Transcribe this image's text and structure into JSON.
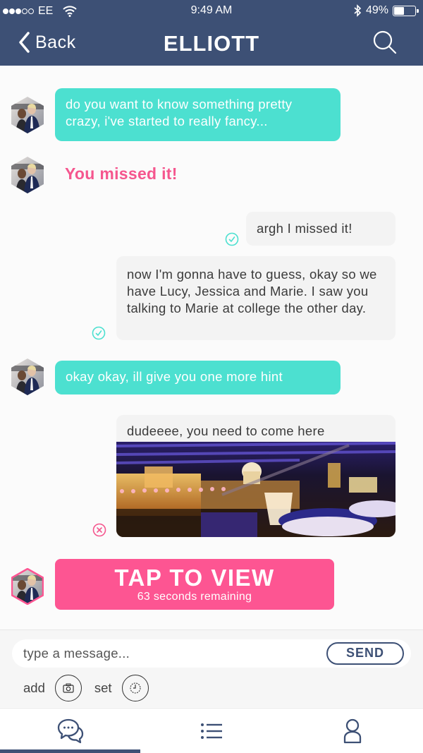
{
  "status_bar": {
    "carrier": "EE",
    "signal_bars_filled": 3,
    "signal_bars_total": 5,
    "time": "9:49 AM",
    "battery_percent_label": "49%",
    "battery_level": 0.49
  },
  "nav": {
    "back_label": "Back",
    "title": "ELLIOTT"
  },
  "colors": {
    "header": "#3d5075",
    "incoming_bubble": "#4ce0d0",
    "accent_pink": "#fd5592",
    "check_teal": "#4ce0d0",
    "error_pink": "#f5568e"
  },
  "messages": [
    {
      "direction": "incoming",
      "text": "do you want to know something pretty crazy, i've started to really fancy..."
    },
    {
      "direction": "incoming",
      "type": "missed",
      "text": "You missed it!"
    },
    {
      "direction": "outgoing",
      "text": "argh I missed it!",
      "status": "delivered"
    },
    {
      "direction": "outgoing",
      "text": "now I'm gonna have to guess, okay so we have Lucy, Jessica and Marie. I saw you talking to Marie at college the other day.",
      "status": "delivered"
    },
    {
      "direction": "incoming",
      "text": "okay okay, ill give you one more hint"
    },
    {
      "direction": "outgoing",
      "type": "photo",
      "text": "dudeeee, you need to come here",
      "image_desc": "night-time rooftop restaurant overlooking London skyline with St Paul's Cathedral",
      "status": "failed"
    },
    {
      "direction": "incoming",
      "type": "timed",
      "title": "TAP TO VIEW",
      "subtitle": "63 seconds remaining"
    }
  ],
  "composer": {
    "placeholder": "type a message...",
    "send_label": "SEND",
    "add_label": "add",
    "set_label": "set"
  },
  "tabbar": {
    "tabs": [
      {
        "name": "chats",
        "icon": "chat-bubbles-icon",
        "active": true
      },
      {
        "name": "list",
        "icon": "list-icon",
        "active": false
      },
      {
        "name": "profile",
        "icon": "person-icon",
        "active": false
      }
    ]
  }
}
